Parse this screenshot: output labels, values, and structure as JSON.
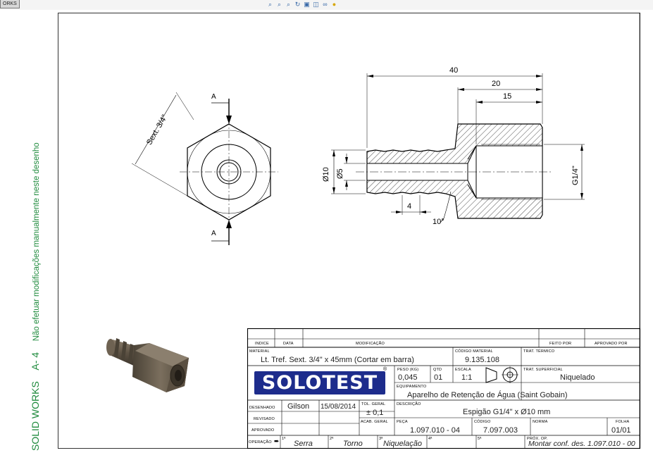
{
  "app": {
    "tab_label": "ORKS"
  },
  "toolbar": {
    "icons": [
      "zoom-fit-icon",
      "zoom-area-icon",
      "zoom-prev-icon",
      "rotate-icon",
      "section-view-icon",
      "display-style-icon",
      "view-settings-icon",
      "appearance-icon"
    ]
  },
  "sidebar": {
    "software": "SOLID WORKS",
    "format": "A- 4",
    "note": "Não efetuar modificações manualmente neste desenho"
  },
  "drawing": {
    "dims": {
      "d40": "40",
      "d20": "20",
      "d15": "15",
      "d4": "4",
      "angle": "10°",
      "dia10": "Ø10",
      "dia5": "Ø5",
      "thread": "G1/4\"",
      "hex": "Sext. 3/4\"",
      "sec_a": "A"
    }
  },
  "title_block": {
    "labels": {
      "indice": "INDICE",
      "data": "DATA",
      "modificacao": "MODIFICAÇÃO",
      "feito_por": "FEITO POR",
      "aprovado_por": "APROVADO POR",
      "material": "MATERIAL",
      "codigo_material": "CÓDIGO MATERIAL",
      "trat_termico": "TRAT. TÉRMICO",
      "peso": "PESO (KG)",
      "qtd": "QTD",
      "escala": "ESCALA",
      "trat_superficial": "TRAT. SUPERFICIAL",
      "equipamento": "EQUIPAMENTO",
      "desenhado": "DESENHADO",
      "tol_geral": "TOL. GERAL",
      "descricao": "DESCRIÇÃO",
      "revisado": "REVISADO",
      "acab_geral": "ACAB. GERAL",
      "peca": "PEÇA",
      "codigo": "CÓDIGO",
      "norma": "NORMA",
      "folha": "FOLHA",
      "aprovado": "APROVADO",
      "operacao": "OPERAÇÃO",
      "op1": "1ª",
      "op2": "2ª",
      "op3": "3ª",
      "op4": "4ª",
      "op5": "5ª",
      "prox_op": "PRÓX. OP."
    },
    "values": {
      "material": "Lt. Tref. Sext. 3/4\" x 45mm (Cortar em barra)",
      "codigo_material": "9.135.108",
      "peso": "0,045",
      "qtd": "01",
      "escala": "1:1",
      "trat_superficial": "Niquelado",
      "equipamento": "Aparelho de Retenção de Água (Saint Gobain)",
      "desenhado": "Gilson",
      "data": "15/08/2014",
      "tol_geral": "± 0,1",
      "descricao": "Espigão G1/4\" x Ø10 mm",
      "peca": "1.097.010 - 04",
      "codigo": "7.097.003",
      "folha": "01/01",
      "op1": "Serra",
      "op2": "Torno",
      "op3": "Niquelação",
      "prox_op": "Montar conf. des. 1.097.010 - 00"
    },
    "logo": {
      "text": "SOLOTEST",
      "reg": "®",
      "color": "#1d2c8c"
    }
  },
  "colors": {
    "sidebar_text": "#1e8a3c",
    "logo_bg": "#1d2c8c",
    "part_metal": "#6b5e4d"
  }
}
